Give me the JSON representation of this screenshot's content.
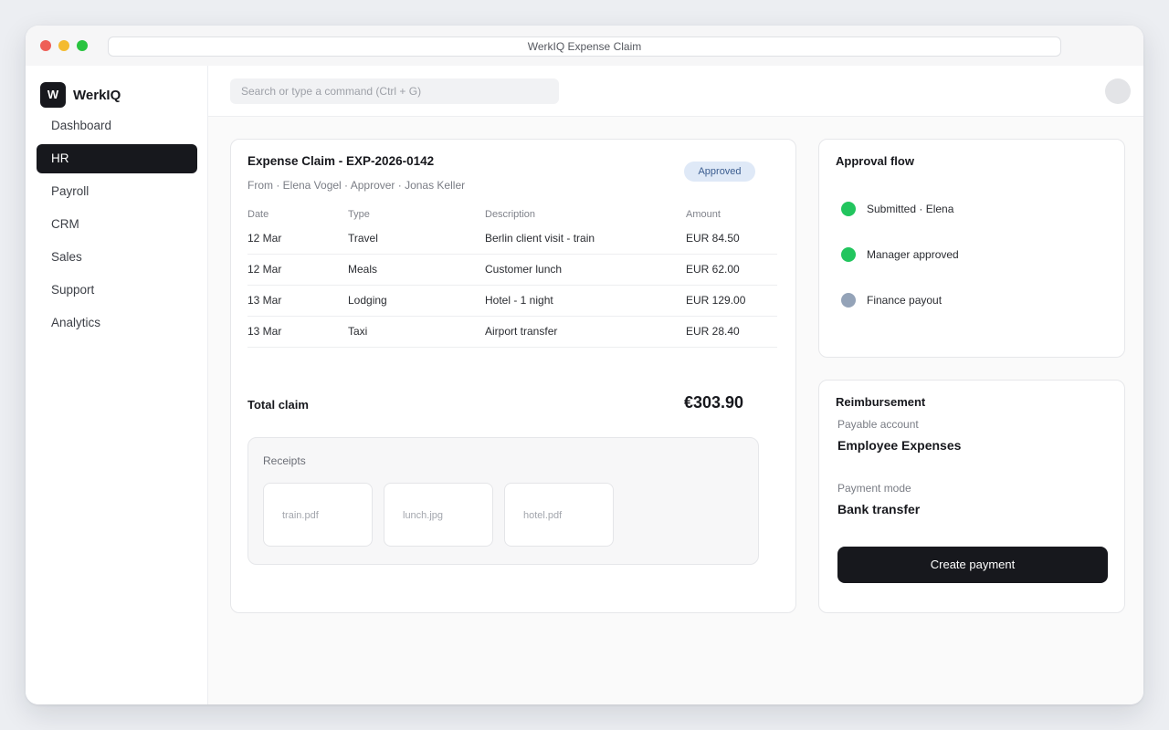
{
  "window": {
    "title": "WerkIQ Expense Claim"
  },
  "sidebar": {
    "logo_letter": "W",
    "brand": "WerkIQ",
    "items": [
      {
        "label": "Dashboard",
        "active": false
      },
      {
        "label": "HR",
        "active": true
      },
      {
        "label": "Payroll",
        "active": false
      },
      {
        "label": "CRM",
        "active": false
      },
      {
        "label": "Sales",
        "active": false
      },
      {
        "label": "Support",
        "active": false
      },
      {
        "label": "Analytics",
        "active": false
      }
    ]
  },
  "topbar": {
    "search_placeholder": "Search or type a command (Ctrl + G)"
  },
  "claim": {
    "title": "Expense Claim - EXP-2026-0142",
    "meta": "From · Elena Vogel · Approver · Jonas Keller",
    "status": "Approved",
    "columns": [
      "Date",
      "Type",
      "Description",
      "Amount"
    ],
    "rows": [
      {
        "date": "12 Mar",
        "type": "Travel",
        "description": "Berlin client visit - train",
        "amount": "EUR 84.50"
      },
      {
        "date": "12 Mar",
        "type": "Meals",
        "description": "Customer lunch",
        "amount": "EUR 62.00"
      },
      {
        "date": "13 Mar",
        "type": "Lodging",
        "description": "Hotel - 1 night",
        "amount": "EUR 129.00"
      },
      {
        "date": "13 Mar",
        "type": "Taxi",
        "description": "Airport transfer",
        "amount": "EUR 28.40"
      }
    ],
    "total_label": "Total claim",
    "total_value": "€303.90",
    "receipts_label": "Receipts",
    "receipts": [
      "train.pdf",
      "lunch.jpg",
      "hotel.pdf"
    ]
  },
  "approval_flow": {
    "title": "Approval flow",
    "steps": [
      {
        "label": "Submitted · Elena",
        "state": "done"
      },
      {
        "label": "Manager approved",
        "state": "done"
      },
      {
        "label": "Finance payout",
        "state": "pending"
      }
    ]
  },
  "reimbursement": {
    "title": "Reimbursement",
    "payable_account_label": "Payable account",
    "payable_account_value": "Employee Expenses",
    "payment_mode_label": "Payment mode",
    "payment_mode_value": "Bank transfer",
    "create_button": "Create payment"
  },
  "colors": {
    "accent_dark": "#17181d",
    "step_done": "#22c55e",
    "step_pending": "#94a3b8",
    "badge_bg": "#dfe9f7"
  }
}
